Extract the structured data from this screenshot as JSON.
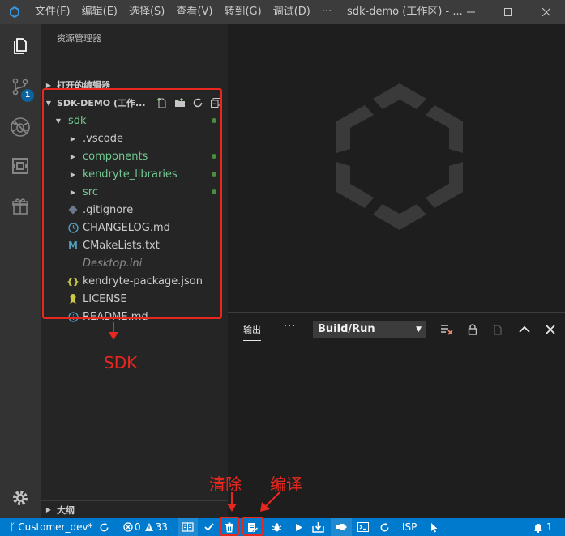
{
  "titlebar": {
    "menus": [
      "文件(F)",
      "编辑(E)",
      "选择(S)",
      "查看(V)",
      "转到(G)",
      "调试(D)",
      "···"
    ],
    "window_title": "sdk-demo (工作区) - ..."
  },
  "activity": {
    "scm_badge": "1"
  },
  "sidebar": {
    "title": "资源管理器",
    "open_editors": "打开的编辑器",
    "workspace": "SDK-DEMO (工作...",
    "outline": "大纲",
    "tree": [
      {
        "label": "sdk",
        "kind": "folder-open",
        "color": "#73c991",
        "dot": true
      },
      {
        "label": ".vscode",
        "kind": "folder",
        "color": "#cccccc",
        "dot": false
      },
      {
        "label": "components",
        "kind": "folder",
        "color": "#73c991",
        "dot": true
      },
      {
        "label": "kendryte_libraries",
        "kind": "folder",
        "color": "#73c991",
        "dot": true
      },
      {
        "label": "src",
        "kind": "folder",
        "color": "#73c991",
        "dot": true
      },
      {
        "label": ".gitignore",
        "kind": "git-icon",
        "color": "#cccccc",
        "dot": false
      },
      {
        "label": "CHANGELOG.md",
        "kind": "clock-icon",
        "color": "#cccccc",
        "dot": false
      },
      {
        "label": "CMakeLists.txt",
        "kind": "cmake-icon",
        "color": "#cccccc",
        "dot": false
      },
      {
        "label": "Desktop.ini",
        "kind": "none",
        "color": "#8c8c8c",
        "dot": false
      },
      {
        "label": "kendryte-package.json",
        "kind": "json-icon",
        "color": "#cccccc",
        "dot": false
      },
      {
        "label": "LICENSE",
        "kind": "license-icon",
        "color": "#cccccc",
        "dot": false
      },
      {
        "label": "README.md",
        "kind": "info-icon",
        "color": "#cccccc",
        "dot": false
      }
    ]
  },
  "panel": {
    "tab_output": "输出",
    "more": "···",
    "channel": "Build/Run"
  },
  "statusbar": {
    "branch": "Customer_dev*",
    "errors": "0",
    "warnings": "33",
    "isp": "ISP",
    "notifications": "1"
  },
  "annotations": {
    "sdk": "SDK",
    "clear": "清除",
    "compile": "编译"
  },
  "colors": {
    "accent": "#007acc",
    "annotation_red": "#e8281e",
    "git_added": "#73c991"
  }
}
